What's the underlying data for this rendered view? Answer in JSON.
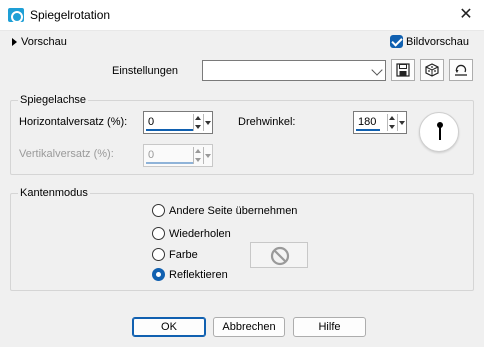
{
  "window": {
    "title": "Spiegelrotation",
    "close_glyph": "✕"
  },
  "preview": {
    "label": "Vorschau",
    "bildvorschau_label": "Bildvorschau",
    "bildvorschau_checked": true
  },
  "settings": {
    "label": "Einstellungen",
    "value": ""
  },
  "mirror_axis": {
    "group_label": "Spiegelachse",
    "horizontal_label": "Horizontalversatz (%):",
    "horizontal_value": "0",
    "vertical_label": "Vertikalversatz (%):",
    "vertical_value": "0",
    "angle_label": "Drehwinkel:",
    "angle_value": "180"
  },
  "edge_mode": {
    "group_label": "Kantenmodus",
    "options": [
      {
        "label": "Andere Seite übernehmen",
        "selected": false
      },
      {
        "label": "Wiederholen",
        "selected": false
      },
      {
        "label": "Farbe",
        "selected": false
      },
      {
        "label": "Reflektieren",
        "selected": true
      }
    ]
  },
  "buttons": {
    "ok": "OK",
    "cancel": "Abbrechen",
    "help": "Hilfe"
  },
  "colors": {
    "accent": "#1060b0",
    "app_icon": "#1e9fd6"
  },
  "icons": [
    "app-icon",
    "close-icon",
    "expand-arrow-icon",
    "save-preset-icon",
    "randomize-dice-icon",
    "reset-icon",
    "angle-dial-icon",
    "no-color-icon"
  ]
}
